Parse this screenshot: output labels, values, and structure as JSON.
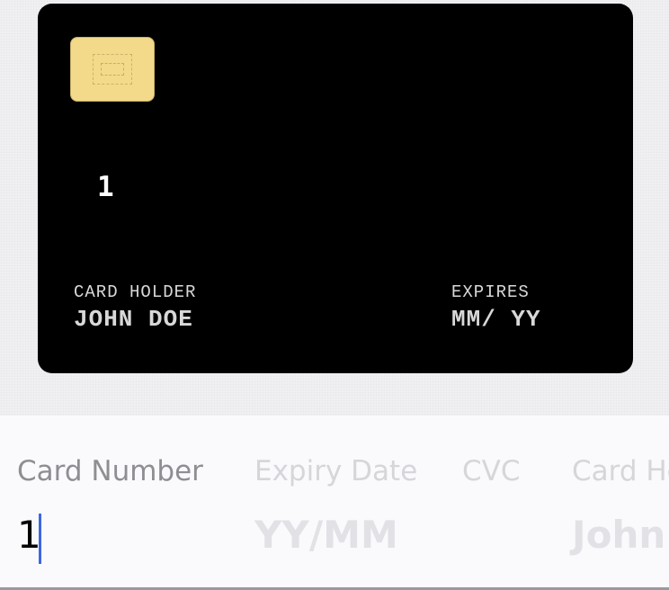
{
  "card": {
    "number": "1",
    "holder_label": "CARD HOLDER",
    "holder_value": "JOHN DOE",
    "expires_label": "EXPIRES",
    "expires_value": "MM/ YY"
  },
  "form": {
    "card_number": {
      "label": "Card Number",
      "value": "1"
    },
    "expiry_date": {
      "label": "Expiry Date",
      "placeholder": "YY/MM"
    },
    "cvc": {
      "label": "CVC"
    },
    "card_holder": {
      "label": "Card Holder",
      "placeholder": "John Doe"
    }
  },
  "colors": {
    "card_background": "#000000",
    "chip": "#f3d98a",
    "caret": "#3d67e0",
    "active_label": "#8e8e93",
    "inactive_label": "#d6d6da"
  }
}
